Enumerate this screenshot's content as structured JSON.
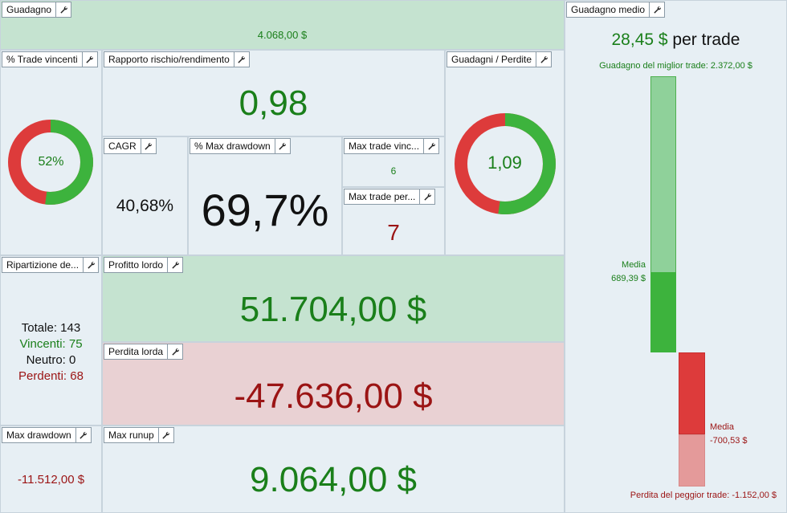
{
  "colors": {
    "green": "#3db33d",
    "red": "#dd3b3b",
    "green_text": "#1a7f1a",
    "red_text": "#9b1414",
    "green_panel": "#c5e3d0",
    "red_panel": "#e9d1d3",
    "panel": "#e7eff4"
  },
  "icons": {
    "settings": "wrench-icon"
  },
  "guadagno": {
    "title": "Guadagno",
    "value": "4.068,00 $"
  },
  "trade_vincenti": {
    "title": "% Trade vincenti",
    "value": "52%",
    "percent": 52
  },
  "rischio": {
    "title": "Rapporto rischio/rendimento",
    "value": "0,98"
  },
  "guadagni_perdite": {
    "title": "Guadagni / Perdite",
    "value": "1,09",
    "ratio": 1.09
  },
  "cagr": {
    "title": "CAGR",
    "value": "40,68%"
  },
  "max_dd_pct": {
    "title": "% Max drawdown",
    "value": "69,7%"
  },
  "max_trade_vinc": {
    "title": "Max trade vinc...",
    "value": "6"
  },
  "max_trade_per": {
    "title": "Max trade per...",
    "value": "7"
  },
  "ripartizione": {
    "title": "Ripartizione de...",
    "totale_label": "Totale:",
    "totale": "143",
    "vincenti_label": "Vincenti:",
    "vincenti": "75",
    "neutro_label": "Neutro:",
    "neutro": "0",
    "perdenti_label": "Perdenti:",
    "perdenti": "68"
  },
  "profitto": {
    "title": "Profitto lordo",
    "value": "51.704,00 $"
  },
  "perdita": {
    "title": "Perdita lorda",
    "value": "-47.636,00 $"
  },
  "max_drawdown": {
    "title": "Max drawdown",
    "value": "-11.512,00 $"
  },
  "max_runup": {
    "title": "Max runup",
    "value": "9.064,00 $"
  },
  "guadagno_medio": {
    "title": "Guadagno medio",
    "value": "28,45 $",
    "suffix": "per trade",
    "best_label": "Guadagno del miglior trade: 2.372,00 $",
    "worst_label": "Perdita del peggior trade: -1.152,00 $",
    "media_win_label": "Media",
    "media_win_value": "689,39 $",
    "media_loss_label": "Media",
    "media_loss_value": "-700,53 $",
    "best": 2372,
    "avg_win": 689.39,
    "worst": -1152,
    "avg_loss": -700.53
  }
}
